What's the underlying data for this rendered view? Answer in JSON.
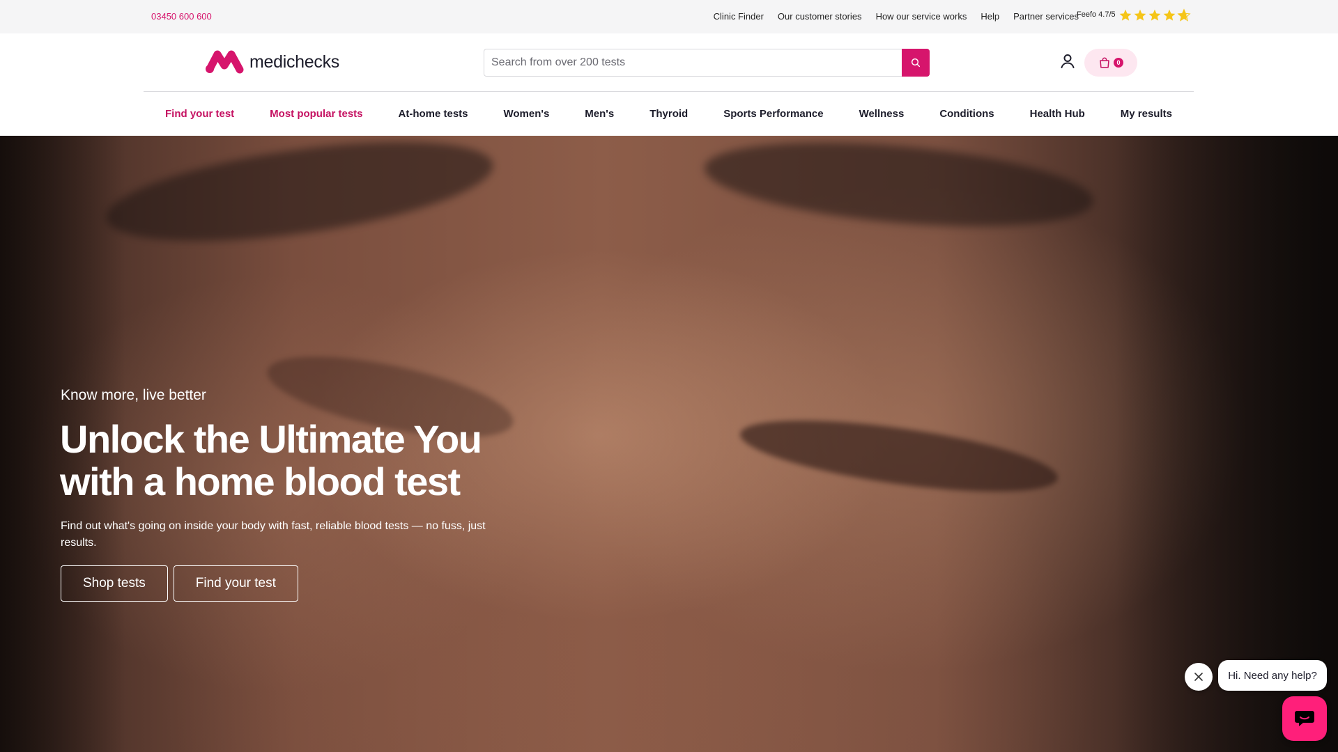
{
  "topbar": {
    "phone": "03450 600 600",
    "links": [
      "Clinic Finder",
      "Our customer stories",
      "How our service works",
      "Help",
      "Partner services"
    ],
    "feefo_label": "Feefo 4.7/5",
    "rating": 4.7,
    "star_color": "#f5c518"
  },
  "header": {
    "logo_text": "medichecks",
    "search_placeholder": "Search from over 200 tests",
    "basket_count": "0",
    "brand_color": "#d6156c"
  },
  "nav": {
    "items": [
      {
        "label": "Find your test"
      },
      {
        "label": "Most popular tests"
      },
      {
        "label": "At-home tests"
      },
      {
        "label": "Women's"
      },
      {
        "label": "Men's"
      },
      {
        "label": "Thyroid"
      },
      {
        "label": "Sports Performance"
      },
      {
        "label": "Wellness"
      },
      {
        "label": "Conditions"
      },
      {
        "label": "Health Hub"
      },
      {
        "label": "My results"
      }
    ]
  },
  "hero": {
    "tagline": "Know more, live better",
    "title": "Unlock the Ultimate You with a home blood test",
    "subtitle": "Find out what's going on inside your body with fast, reliable blood tests — no fuss, just results.",
    "primary_button": "Shop tests",
    "secondary_button": "Find your test"
  },
  "chat": {
    "prompt": "Hi. Need any help?"
  }
}
